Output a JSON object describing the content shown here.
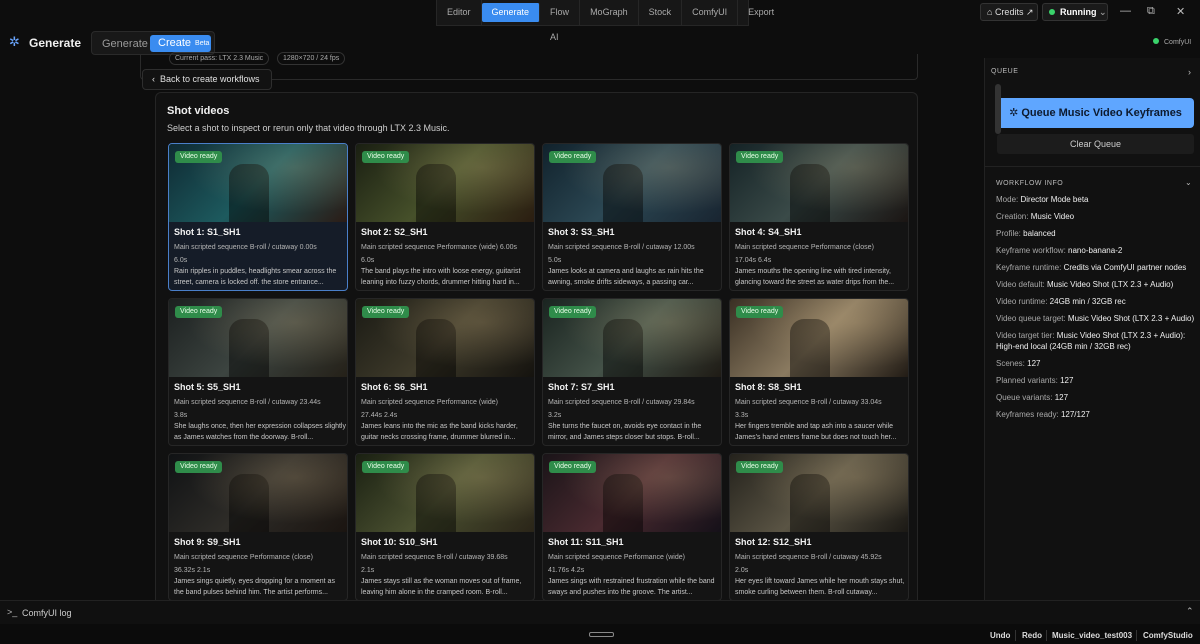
{
  "app": {
    "title": "Generate",
    "comfy_status": "ComfyUI"
  },
  "mode_switch": {
    "generate": "Generate",
    "create": "Create",
    "create_badge": "Beta"
  },
  "top_tabs": [
    "Editor",
    "Generate",
    "Flow AI",
    "MoGraph",
    "Stock",
    "ComfyUI",
    "Export"
  ],
  "top_tabs_active": "Generate",
  "header_right": {
    "credits": "Credits",
    "running": "Running"
  },
  "pass_info": {
    "current_pass": "Current pass: LTX 2.3 Music",
    "resolution": "1280×720 / 24 fps"
  },
  "back_button": "Back to create workflows",
  "shots_panel": {
    "title": "Shot videos",
    "subtitle": "Select a shot to inspect or rerun only that video through LTX 2.3 Music."
  },
  "shots": [
    {
      "badge": "Video ready",
      "title": "Shot 1: S1_SH1",
      "meta": "Main scripted sequence  B-roll / cutaway  0.00s",
      "meta2": "6.0s",
      "desc": "Rain ripples in puddles, headlights smear across the street, camera is locked off. the store entrance...",
      "colors": [
        "#0f2a33",
        "#1d5a5e",
        "#2b1a14"
      ]
    },
    {
      "badge": "Video ready",
      "title": "Shot 2: S2_SH1",
      "meta": "Main scripted sequence  Performance (wide)  6.00s",
      "meta2": "6.0s",
      "desc": "The band plays the intro with loose energy, guitarist leaning into fuzzy chords, drummer hitting hard in...",
      "colors": [
        "#1a1f12",
        "#46502a",
        "#2a1c10"
      ]
    },
    {
      "badge": "Video ready",
      "title": "Shot 3: S3_SH1",
      "meta": "Main scripted sequence  B-roll / cutaway  12.00s",
      "meta2": "5.0s",
      "desc": "James looks at camera and laughs as rain hits the awning, smoke drifts sideways, a passing car...",
      "colors": [
        "#11222c",
        "#2c4854",
        "#182430"
      ]
    },
    {
      "badge": "Video ready",
      "title": "Shot 4: S4_SH1",
      "meta": "Main scripted sequence  Performance (close)",
      "meta2": "17.04s  6.4s",
      "desc": "James mouths the opening line with tired intensity, glancing toward the street as water drips from the...",
      "colors": [
        "#152326",
        "#3a4a48",
        "#1a1412"
      ]
    },
    {
      "badge": "Video ready",
      "title": "Shot 5: S5_SH1",
      "meta": "Main scripted sequence  B-roll / cutaway  23.44s",
      "meta2": "3.8s",
      "desc": "She laughs once, then her expression collapses slightly as James watches from the doorway. B-roll...",
      "colors": [
        "#1c2020",
        "#3c4440",
        "#242018"
      ]
    },
    {
      "badge": "Video ready",
      "title": "Shot 6: S6_SH1",
      "meta": "Main scripted sequence  Performance (wide)",
      "meta2": "27.44s  2.4s",
      "desc": "James leans into the mic as the band kicks harder, guitar necks crossing frame, drummer blurred in...",
      "colors": [
        "#1a1a14",
        "#3e3a2a",
        "#14120e"
      ]
    },
    {
      "badge": "Video ready",
      "title": "Shot 7: S7_SH1",
      "meta": "Main scripted sequence  B-roll / cutaway  29.84s",
      "meta2": "3.2s",
      "desc": "She turns the faucet on, avoids eye contact in the mirror, and James steps closer but stops. B-roll...",
      "colors": [
        "#1a2420",
        "#445248",
        "#1e1a14"
      ]
    },
    {
      "badge": "Video ready",
      "title": "Shot 8: S8_SH1",
      "meta": "Main scripted sequence  B-roll / cutaway  33.04s",
      "meta2": "3.3s",
      "desc": "Her fingers tremble and tap ash into a saucer while James's hand enters frame but does not touch her...",
      "colors": [
        "#3a3024",
        "#8a7a60",
        "#201a14"
      ]
    },
    {
      "badge": "Video ready",
      "title": "Shot 9: S9_SH1",
      "meta": "Main scripted sequence  Performance (close)",
      "meta2": "36.32s  2.1s",
      "desc": "James sings quietly, eyes dropping for a moment as the band pulses behind him. The artist performs...",
      "colors": [
        "#101214",
        "#2e2c28",
        "#1a1410"
      ]
    },
    {
      "badge": "Video ready",
      "title": "Shot 10: S10_SH1",
      "meta": "Main scripted sequence  B-roll / cutaway  39.68s",
      "meta2": "2.1s",
      "desc": "James stays still as the woman moves out of frame, leaving him alone in the cramped room. B-roll...",
      "colors": [
        "#1a2012",
        "#4a5030",
        "#2a2418"
      ]
    },
    {
      "badge": "Video ready",
      "title": "Shot 11: S11_SH1",
      "meta": "Main scripted sequence  Performance (wide)",
      "meta2": "41.76s  4.2s",
      "desc": "James sings with restrained frustration while the band sways and pushes into the groove. The artist...",
      "colors": [
        "#1a1418",
        "#4a2a30",
        "#141018"
      ]
    },
    {
      "badge": "Video ready",
      "title": "Shot 12: S12_SH1",
      "meta": "Main scripted sequence  B-roll / cutaway  45.92s",
      "meta2": "2.0s",
      "desc": "Her eyes lift toward James while her mouth stays shut, smoke curling between them. B-roll cutaway...",
      "colors": [
        "#24221c",
        "#5a5444",
        "#1a1814"
      ]
    }
  ],
  "queue": {
    "header": "QUEUE",
    "queue_button": "Queue Music Video Keyframes",
    "clear_button": "Clear Queue"
  },
  "workflow_info": {
    "header": "WORKFLOW INFO",
    "rows": [
      {
        "label": "Mode:",
        "value": "Director Mode beta"
      },
      {
        "label": "Creation:",
        "value": "Music Video"
      },
      {
        "label": "Profile:",
        "value": "balanced"
      },
      {
        "label": "Keyframe workflow:",
        "value": "nano-banana-2"
      },
      {
        "label": "Keyframe runtime:",
        "value": "Credits via ComfyUI partner nodes"
      },
      {
        "label": "Video default:",
        "value": "Music Video Shot (LTX 2.3 + Audio)"
      },
      {
        "label": "Video runtime:",
        "value": "24GB min / 32GB rec"
      },
      {
        "label": "Video queue target:",
        "value": "Music Video Shot (LTX 2.3 + Audio)"
      },
      {
        "label": "Video target tier:",
        "value": "Music Video Shot (LTX 2.3 + Audio): High-end local (24GB min / 32GB rec)"
      },
      {
        "label": "Scenes:",
        "value": "127"
      },
      {
        "label": "Planned variants:",
        "value": "127"
      },
      {
        "label": "Queue variants:",
        "value": "127"
      },
      {
        "label": "Keyframes ready:",
        "value": "127/127"
      }
    ]
  },
  "log_bar": {
    "label": "ComfyUI log"
  },
  "status_bar": {
    "undo": "Undo",
    "redo": "Redo",
    "project": "Music_video_test003",
    "brand": "ComfyStudio"
  }
}
